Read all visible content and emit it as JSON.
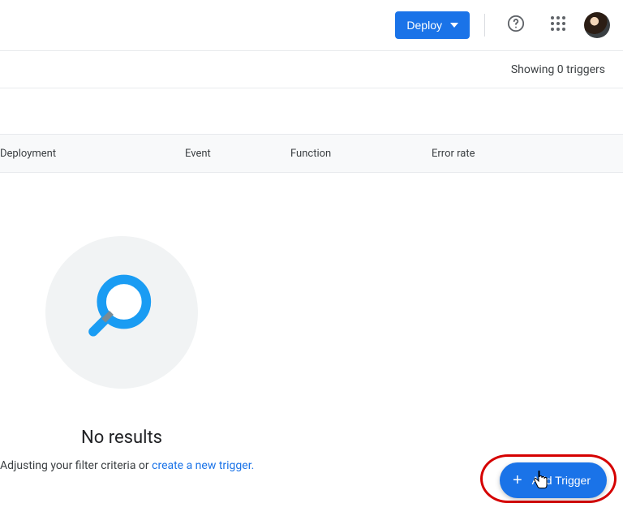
{
  "header": {
    "deploy_label": "Deploy"
  },
  "status": {
    "text": "Showing 0 triggers"
  },
  "table": {
    "columns": {
      "deployment": "Deployment",
      "event": "Event",
      "function": "Function",
      "error_rate": "Error rate"
    }
  },
  "empty": {
    "title": "No results",
    "sub_prefix": "Adjusting your filter criteria or ",
    "link_text": "create a new trigger."
  },
  "fab": {
    "label": "Add Trigger"
  }
}
